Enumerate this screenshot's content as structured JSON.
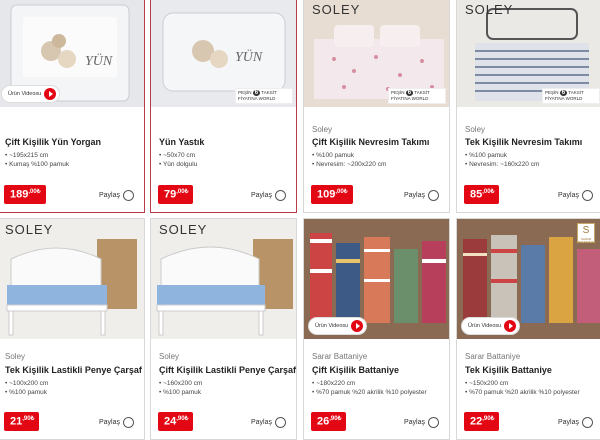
{
  "share_label": "Paylaş",
  "video_label": "Ürün Videosu",
  "taksit": {
    "line1": "PEŞİN",
    "line2": "FİYATINA",
    "number": "6",
    "suffix": "TAKSİT",
    "cards": "WORLD"
  },
  "image_brands": {
    "soley": "SOLEY",
    "sarar_mark": "S",
    "sarar_text": "SARAR BATTANİYE",
    "yuntas": "YÜN"
  },
  "products": [
    {
      "brand": "",
      "title": "Çift Kişilik Yün Yorgan",
      "features": [
        "~195x215 cm",
        "Kumaş %100 pamuk"
      ],
      "price_int": "189",
      "price_dec": ",00",
      "currency": "₺"
    },
    {
      "brand": "",
      "title": "Yün Yastık",
      "features": [
        "~50x70 cm",
        "Yün dolgulu"
      ],
      "price_int": "79",
      "price_dec": ",00",
      "currency": "₺"
    },
    {
      "brand": "Soley",
      "title": "Çift Kişilik Nevresim Takımı",
      "features": [
        "%100 pamuk",
        "Nevresim: ~200x220 cm"
      ],
      "price_int": "109",
      "price_dec": ",00",
      "currency": "₺"
    },
    {
      "brand": "Soley",
      "title": "Tek Kişilik Nevresim Takımı",
      "features": [
        "%100 pamuk",
        "Nevresim: ~160x220 cm"
      ],
      "price_int": "85",
      "price_dec": ",00",
      "currency": "₺"
    },
    {
      "brand": "Soley",
      "title": "Tek Kişilik Lastikli Penye Çarşaf",
      "features": [
        "~100x200 cm",
        "%100 pamuk"
      ],
      "price_int": "21",
      "price_dec": ",90",
      "currency": "₺"
    },
    {
      "brand": "Soley",
      "title": "Çift Kişilik Lastikli Penye Çarşaf",
      "features": [
        "~160x200 cm",
        "%100 pamuk"
      ],
      "price_int": "24",
      "price_dec": ",90",
      "currency": "₺"
    },
    {
      "brand": "Sarar Battaniye",
      "title": "Çift Kişilik Battaniye",
      "features": [
        "~180x220 cm",
        "%70 pamuk %20 akrilik %10 polyester"
      ],
      "price_int": "26",
      "price_dec": ",90",
      "currency": "₺"
    },
    {
      "brand": "Sarar Battaniye",
      "title": "Tek Kişilik Battaniye",
      "features": [
        "~150x200 cm",
        "%70 pamuk %20 akrilik %10 polyester"
      ],
      "price_int": "22",
      "price_dec": ",90",
      "currency": "₺"
    }
  ]
}
